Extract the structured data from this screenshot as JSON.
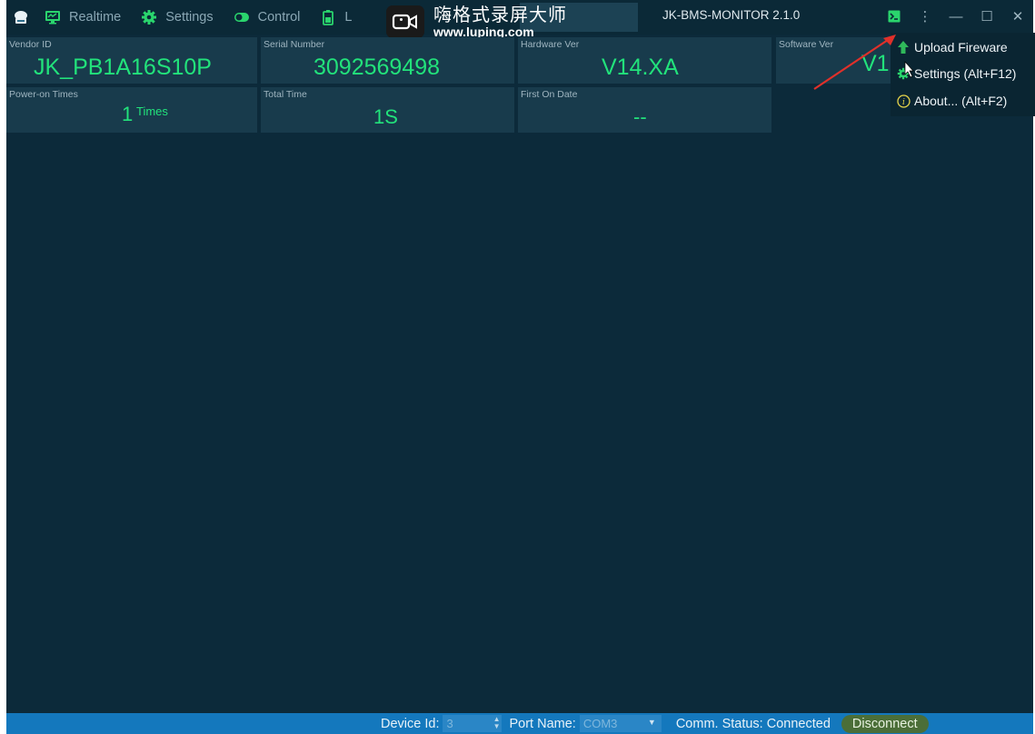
{
  "nav": {
    "items": [
      {
        "label": "Realtime",
        "icon": "monitor-icon"
      },
      {
        "label": "Settings",
        "icon": "gear-icon"
      },
      {
        "label": "Control",
        "icon": "toggle-icon"
      },
      {
        "label": "L",
        "icon": "battery-icon"
      }
    ]
  },
  "watermark": {
    "title": "嗨格式录屏大师",
    "url": "www.luping.com"
  },
  "app_title": "JK-BMS-MONITOR 2.1.0",
  "window_buttons": {
    "more": "⋮",
    "minimize": "—",
    "maximize": "☐",
    "close": "✕"
  },
  "info": {
    "vendor": {
      "label": "Vendor ID",
      "value": "JK_PB1A16S10P"
    },
    "serial": {
      "label": "Serial Number",
      "value": "3092569498"
    },
    "hardware": {
      "label": "Hardware Ver",
      "value": "V14.XA"
    },
    "software": {
      "label": "Software Ver",
      "value": "V1"
    },
    "power_on": {
      "label": "Power-on Times",
      "value": "1",
      "unit": "Times"
    },
    "total_time": {
      "label": "Total Time",
      "value": "1S"
    },
    "first_on": {
      "label": "First On Date",
      "value": "--"
    }
  },
  "menu": {
    "items": [
      {
        "label": "Upload Fireware",
        "icon": "upload-arrow-icon"
      },
      {
        "label": "Settings (Alt+F12)",
        "icon": "gear-icon"
      },
      {
        "label": "About... (Alt+F2)",
        "icon": "info-icon"
      }
    ]
  },
  "status": {
    "device_id_label": "Device Id:",
    "device_id_value": "3",
    "port_name_label": "Port Name:",
    "port_name_value": "COM3",
    "comm_status": "Comm. Status: Connected",
    "disconnect_label": "Disconnect"
  },
  "colors": {
    "background": "#0c2a3a",
    "card": "#183b4c",
    "value_green": "#22e27b",
    "status_bar": "#1478bd",
    "annotation_arrow": "#e0302a"
  }
}
